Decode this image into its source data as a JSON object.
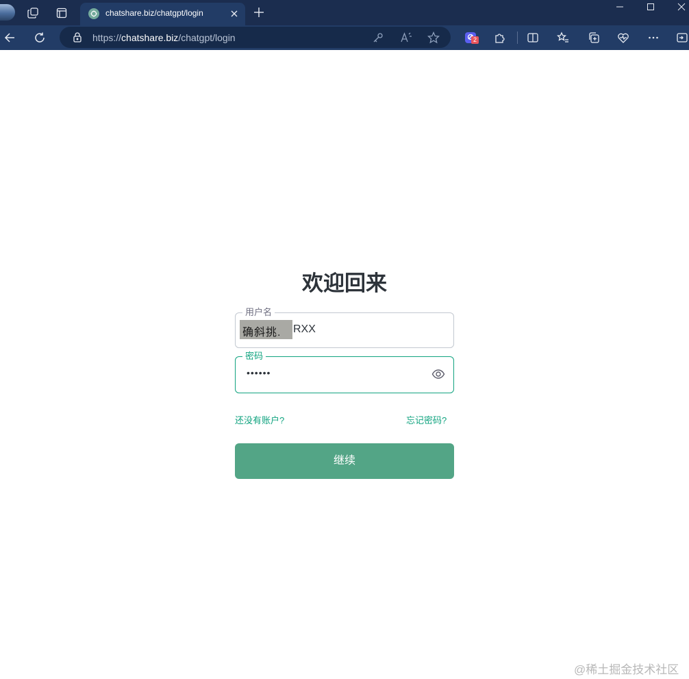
{
  "browser": {
    "tab_title": "chatshare.biz/chatgpt/login",
    "url_prefix": "https://",
    "url_domain": "chatshare.biz",
    "url_path": "/chatgpt/login",
    "extension_badge_count": "2"
  },
  "login": {
    "title": "欢迎回来",
    "username": {
      "label": "用户名",
      "redacted_prefix": "确斜挑.",
      "visible_suffix": "RXX"
    },
    "password": {
      "label": "密码",
      "masked_value": "••••••"
    },
    "no_account_link": "还没有账户?",
    "forgot_password_link": "忘记密码?",
    "continue_button": "继续"
  },
  "watermark": "@稀土掘金技术社区",
  "colors": {
    "brand_green": "#10a37f",
    "button_green": "#53a586",
    "browser_frame": "#1b2d4f"
  }
}
